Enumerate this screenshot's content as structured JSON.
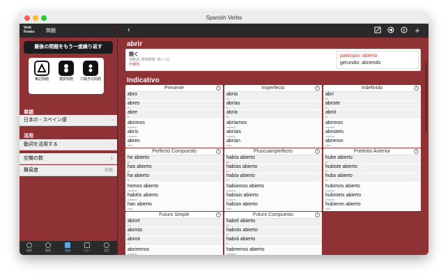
{
  "window": {
    "title": "Spanish Verbs"
  },
  "sidebar": {
    "logo": "Verb Forms",
    "title": "問題",
    "retry_label": "最後の問題をもう一度繰り返す",
    "modes": [
      {
        "label": "筆記問題",
        "icon": "pen-triangle-icon",
        "selected": true
      },
      {
        "label": "選択問題",
        "icon": "choice-ab-icon",
        "selected": false
      },
      {
        "label": "穴開きの問題",
        "icon": "blanks-icon",
        "selected": false
      }
    ],
    "word_section": "単語",
    "word_row": "日本の - スペイン語",
    "use_section": "活用",
    "use_row": "動詞を活用する",
    "blanks_label": "空欄の数",
    "blanks_value": "1",
    "difficulty_label": "難易度",
    "difficulty_value": "初級",
    "tabs": [
      {
        "label": "検索",
        "icon": "search-icon"
      },
      {
        "label": "動詞",
        "icon": "verb-icon"
      },
      {
        "label": "問題",
        "icon": "quiz-icon",
        "active": true
      },
      {
        "label": "リスト",
        "icon": "list-icon"
      },
      {
        "label": "設定",
        "icon": "gear-icon"
      }
    ]
  },
  "main": {
    "verb": "abrir",
    "meaning": "開く",
    "frequency": "他動詞, 使用頻度: 高い (1)",
    "irregular": "不規則",
    "participle_label": "participio:",
    "participle_value": "abierto",
    "gerund_label": "gerundio:",
    "gerund_value": "abriendo",
    "mood": "Indicativo",
    "info_glyph": "i",
    "tenses": [
      {
        "name": "Presente",
        "forms": [
          {
            "f": "abro",
            "p": "yo"
          },
          {
            "f": "abres",
            "p": "tú"
          },
          {
            "f": "abre",
            "p": "él"
          },
          {
            "f": "abrimos",
            "p": "nosotros"
          },
          {
            "f": "abrís",
            "p": "vosotros"
          },
          {
            "f": "abren",
            "p": "ellos"
          }
        ]
      },
      {
        "name": "Imperfecto",
        "forms": [
          {
            "f": "abría",
            "p": "yo"
          },
          {
            "f": "abrías",
            "p": "tú"
          },
          {
            "f": "abría",
            "p": "él"
          },
          {
            "f": "abríamos",
            "p": "nosotros"
          },
          {
            "f": "abríais",
            "p": "vosotros"
          },
          {
            "f": "abrían",
            "p": "ellos"
          }
        ]
      },
      {
        "name": "Indefinido",
        "forms": [
          {
            "f": "abrí",
            "p": "yo"
          },
          {
            "f": "abriste",
            "p": "tú"
          },
          {
            "f": "abrió",
            "p": "él"
          },
          {
            "f": "abrimos",
            "p": "nosotros"
          },
          {
            "f": "abristeis",
            "p": "vosotros"
          },
          {
            "f": "abrieron",
            "p": "ellos"
          }
        ]
      },
      {
        "name": "Perfecto Compuesto",
        "forms": [
          {
            "f": "he abierto",
            "p": "yo"
          },
          {
            "f": "has abierto",
            "p": "tú"
          },
          {
            "f": "ha abierto",
            "p": "él"
          },
          {
            "f": "hemos abierto",
            "p": "nosotros"
          },
          {
            "f": "habéis abierto",
            "p": "vosotros"
          },
          {
            "f": "han abierto",
            "p": "ellos"
          }
        ]
      },
      {
        "name": "Pluscuamperfecto",
        "forms": [
          {
            "f": "había abierto",
            "p": "yo"
          },
          {
            "f": "habías abierto",
            "p": "tú"
          },
          {
            "f": "había abierto",
            "p": "él"
          },
          {
            "f": "habíamos abierto",
            "p": "nosotros"
          },
          {
            "f": "habíais abierto",
            "p": "vosotros"
          },
          {
            "f": "habían abierto",
            "p": "ellos"
          }
        ]
      },
      {
        "name": "Pretérito Anterior",
        "forms": [
          {
            "f": "hube abierto",
            "p": "yo"
          },
          {
            "f": "hubiste abierto",
            "p": "tú"
          },
          {
            "f": "hubo abierto",
            "p": "él"
          },
          {
            "f": "hubimos abierto",
            "p": "nosotros"
          },
          {
            "f": "hubisteis abierto",
            "p": "vosotros"
          },
          {
            "f": "hubieron abierto",
            "p": "ellos"
          }
        ]
      },
      {
        "name": "Futuro Simple",
        "forms": [
          {
            "f": "abriré",
            "p": "yo"
          },
          {
            "f": "abrirás",
            "p": "tú"
          },
          {
            "f": "abrirá",
            "p": "él"
          },
          {
            "f": "abriremos",
            "p": "nosotros"
          }
        ]
      },
      {
        "name": "Futuro Compuesto",
        "forms": [
          {
            "f": "habré abierto",
            "p": "yo"
          },
          {
            "f": "habrás abierto",
            "p": "tú"
          },
          {
            "f": "habrá abierto",
            "p": "él"
          },
          {
            "f": "habremos abierto",
            "p": "nosotros"
          }
        ]
      }
    ],
    "toolbar_icons": [
      "edit-icon",
      "audio-icon",
      "info-icon",
      "add-icon"
    ]
  }
}
